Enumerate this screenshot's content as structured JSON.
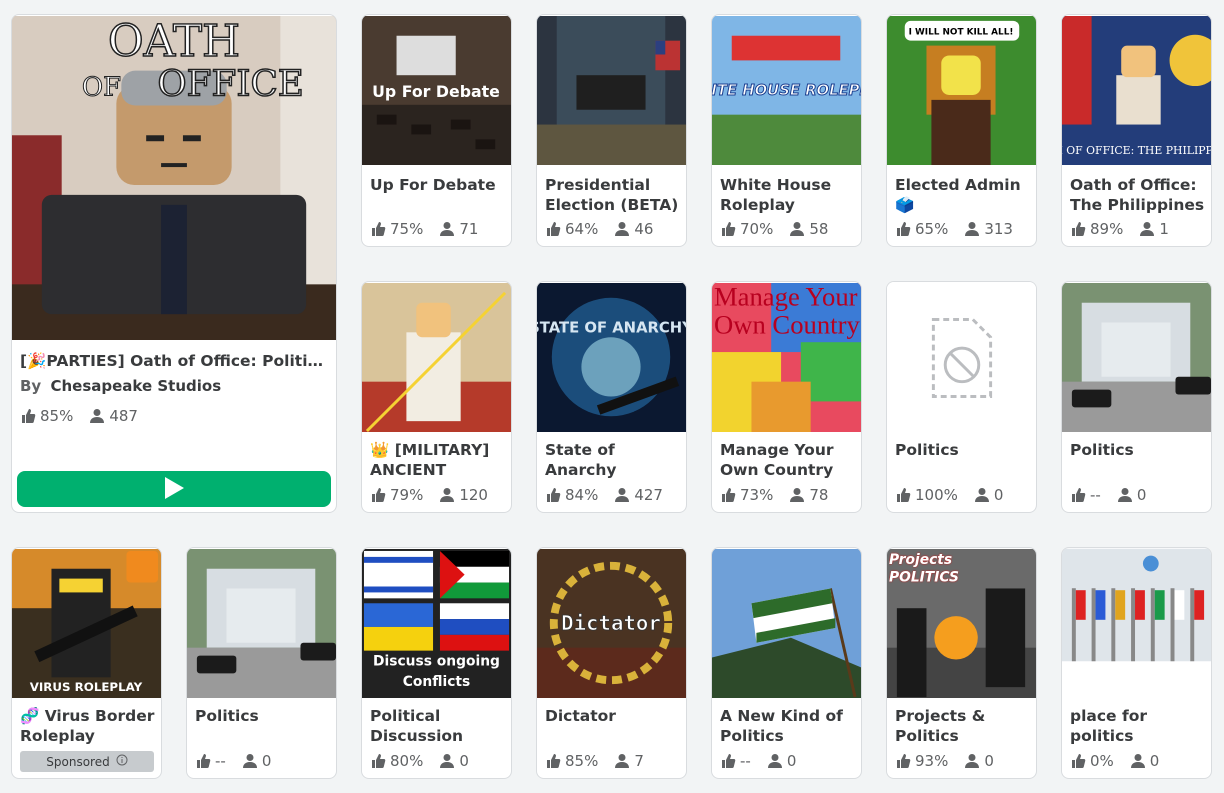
{
  "featured": {
    "title": "[🎉PARTIES] Oath of Office: Political…",
    "by_label": "By",
    "creator": "Chesapeake Studios",
    "thumb_text_1": "OATH",
    "thumb_text_2": "OF",
    "thumb_text_3": "OFFICE",
    "rating": "85%",
    "players": "487"
  },
  "games": [
    {
      "title": "Up For Debate",
      "rating": "75%",
      "players": "71",
      "thumb_text": "Up For Debate"
    },
    {
      "title": "Presidential Election (BETA)",
      "rating": "64%",
      "players": "46"
    },
    {
      "title": "White House Roleplay",
      "rating": "70%",
      "players": "58",
      "thumb_text": "WHITE HOUSE ROLEPLAY"
    },
    {
      "title": "Elected Admin 🗳️",
      "rating": "65%",
      "players": "313",
      "thumb_text": "I WILL NOT KILL ALL!"
    },
    {
      "title": "Oath of Office: The Philippines",
      "rating": "89%",
      "players": "1",
      "thumb_text": "OATH OF OFFICE: THE PHILIPPINES"
    },
    {
      "title": "👑 [MILITARY] ANCIENT EGYPT",
      "rating": "79%",
      "players": "120"
    },
    {
      "title": "State of Anarchy (Hatsune Miku…",
      "rating": "84%",
      "players": "427",
      "thumb_text": "STATE OF ANARCHY"
    },
    {
      "title": "Manage Your Own Country",
      "rating": "73%",
      "players": "78",
      "thumb_text": "Manage Your Own Country"
    },
    {
      "title": "Politics",
      "rating": "100%",
      "players": "0"
    },
    {
      "title": "Politics",
      "rating": "--",
      "players": "0"
    },
    {
      "title": "🧬 Virus Border Roleplay",
      "sponsored": "Sponsored",
      "thumb_text": "VIRUS ROLEPLAY"
    },
    {
      "title": "Politics",
      "rating": "--",
      "players": "0"
    },
    {
      "title": "Political Discussion",
      "rating": "80%",
      "players": "0",
      "thumb_text": "Discuss ongoing Conflicts"
    },
    {
      "title": "Dictator",
      "rating": "85%",
      "players": "7",
      "thumb_text": "Dictator"
    },
    {
      "title": "A New Kind of Politics",
      "rating": "--",
      "players": "0"
    },
    {
      "title": "Projects & Politics",
      "rating": "93%",
      "players": "0",
      "thumb_text": "Projects POLITICS"
    },
    {
      "title": "place for politics (created)",
      "rating": "0%",
      "players": "0"
    }
  ],
  "colors": {
    "play_green": "#00b06f",
    "card_border": "#d9dcdf",
    "bg": "#f2f4f5"
  },
  "icons": {
    "rating": "thumbs-up-icon",
    "players": "players-icon",
    "play": "play-icon",
    "info": "info-icon",
    "broken_image": "broken-image-icon"
  }
}
